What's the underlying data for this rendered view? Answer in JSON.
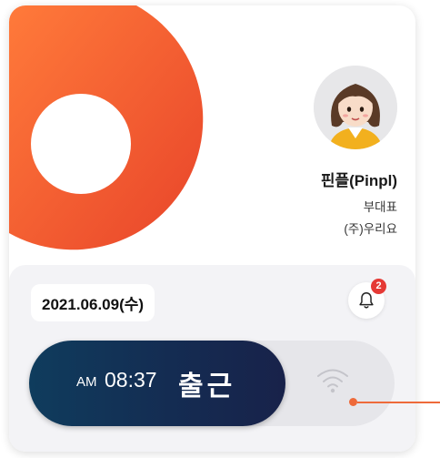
{
  "profile": {
    "name": "핀플(Pinpl)",
    "title": "부대표",
    "company": "(주)우리요"
  },
  "date": "2021.06.09(수)",
  "notifications": {
    "count": "2",
    "icon": "bell-icon"
  },
  "clock": {
    "ampm": "AM",
    "time": "08:37",
    "label": "출근"
  },
  "icons": {
    "wifi": "wifi-icon",
    "avatar": "user-avatar"
  },
  "colors": {
    "accent_orange": "#f15a2b",
    "button_navy": "#142c52",
    "badge_red": "#e53935",
    "panel_bg": "#f3f3f6"
  }
}
